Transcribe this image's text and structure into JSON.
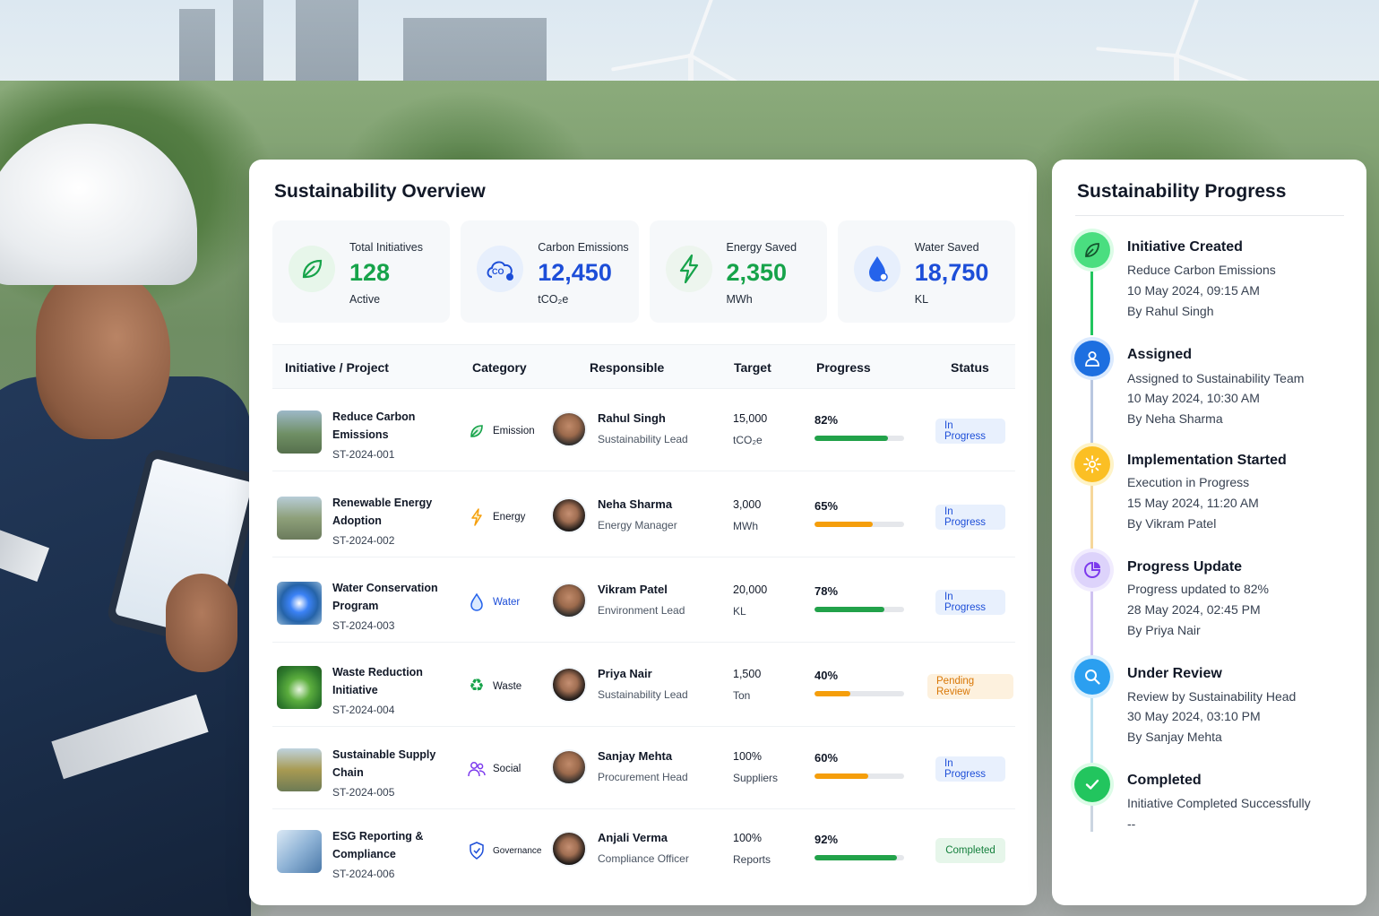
{
  "overview": {
    "title": "Sustainability Overview",
    "kpis": [
      {
        "label": "Total Initiatives",
        "value": "128",
        "unit": "Active",
        "icon": "leaf-icon",
        "color": "#16a34a"
      },
      {
        "label": "Carbon Emissions",
        "value": "12,450",
        "unit": "tCO₂e",
        "icon": "co2-icon",
        "color": "#1d4ed8"
      },
      {
        "label": "Energy Saved",
        "value": "2,350",
        "unit": "MWh",
        "icon": "lightning-icon",
        "color": "#16a34a"
      },
      {
        "label": "Water Saved",
        "value": "18,750",
        "unit": "KL",
        "icon": "water-drop-icon",
        "color": "#1d4ed8"
      }
    ],
    "table": {
      "headers": [
        "Initiative / Project",
        "Category",
        "Responsible",
        "Target",
        "Progress",
        "Status"
      ],
      "rows": [
        {
          "name": "Reduce Carbon Emissions",
          "id": "ST-2024-001",
          "category": "Emission",
          "person": "Rahul Singh",
          "role": "Sustainability Lead",
          "target": "15,000",
          "unit": "tCO₂e",
          "progress": "82%",
          "progress_value": 82,
          "status": "In Progress"
        },
        {
          "name": "Renewable Energy Adoption",
          "id": "ST-2024-002",
          "category": "Energy",
          "person": "Neha Sharma",
          "role": "Energy Manager",
          "target": "3,000",
          "unit": "MWh",
          "progress": "65%",
          "progress_value": 65,
          "status": "In Progress"
        },
        {
          "name": "Water Conservation Program",
          "id": "ST-2024-003",
          "category": "Water",
          "person": "Vikram Patel",
          "role": "Environment Lead",
          "target": "20,000",
          "unit": "KL",
          "progress": "78%",
          "progress_value": 78,
          "status": "In Progress"
        },
        {
          "name": "Waste Reduction Initiative",
          "id": "ST-2024-004",
          "category": "Waste",
          "person": "Priya Nair",
          "role": "Sustainability Lead",
          "target": "1,500",
          "unit": "Ton",
          "progress": "40%",
          "progress_value": 40,
          "status": "Pending Review"
        },
        {
          "name": "Sustainable Supply Chain",
          "id": "ST-2024-005",
          "category": "Social",
          "person": "Sanjay Mehta",
          "role": "Procurement Head",
          "target": "100%",
          "unit": "Suppliers",
          "progress": "60%",
          "progress_value": 60,
          "status": "In Progress"
        },
        {
          "name": "ESG Reporting & Compliance",
          "id": "ST-2024-006",
          "category": "Governance",
          "person": "Anjali Verma",
          "role": "Compliance Officer",
          "target": "100%",
          "unit": "Reports",
          "progress": "92%",
          "progress_value": 92,
          "status": "Completed"
        }
      ]
    }
  },
  "progress": {
    "title": "Sustainability Progress",
    "steps": [
      {
        "title": "Initiative Created",
        "line1": "Reduce Carbon Emissions",
        "line2": "10 May 2024, 09:15 AM",
        "line3": "By Rahul Singh",
        "color": "#22c55e",
        "icon": "leaf-icon"
      },
      {
        "title": "Assigned",
        "line1": "Assigned to Sustainability Team",
        "line2": "10 May 2024, 10:30 AM",
        "line3": "By Neha Sharma",
        "color": "#1d6fe0",
        "icon": "user-icon"
      },
      {
        "title": "Implementation Started",
        "line1": "Execution in Progress",
        "line2": "15 May 2024, 11:20 AM",
        "line3": "By Vikram Patel",
        "color": "#f59e0b",
        "icon": "gear-icon"
      },
      {
        "title": "Progress Update",
        "line1": "Progress updated to 82%",
        "line2": "28 May 2024, 02:45 PM",
        "line3": "By Priya Nair",
        "color": "#8b5cf6",
        "icon": "pie-chart-icon"
      },
      {
        "title": "Under Review",
        "line1": "Review by Sustainability Head",
        "line2": "30 May 2024, 03:10 PM",
        "line3": "By Sanjay Mehta",
        "color": "#0ea5e9",
        "icon": "search-icon"
      },
      {
        "title": "Completed",
        "line1": "Initiative Completed Successfully",
        "line2": "--",
        "line3": "",
        "color": "#22c55e",
        "icon": "check-icon"
      }
    ]
  }
}
